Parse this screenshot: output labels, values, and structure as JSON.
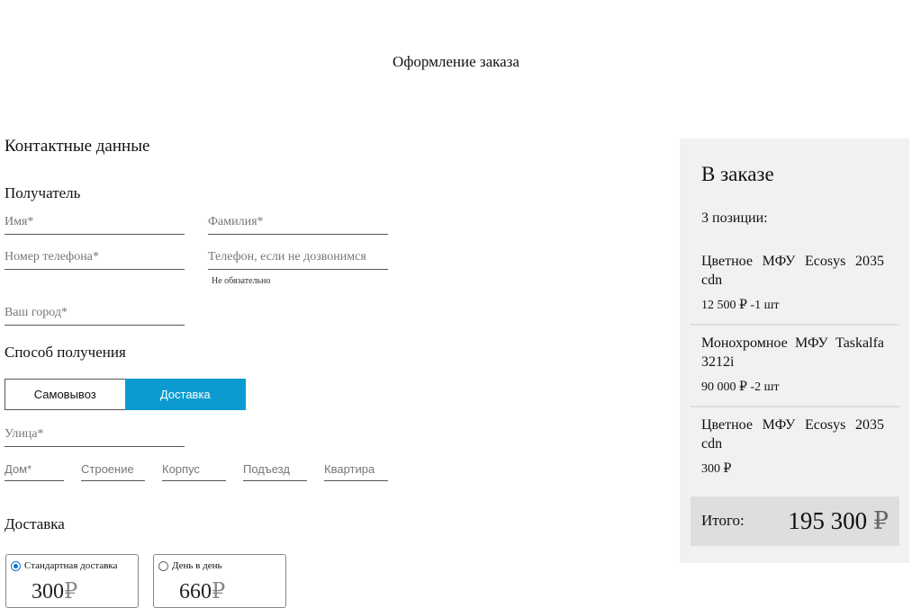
{
  "page_title": "Оформление заказа",
  "contact": {
    "title": "Контактные данные",
    "recipient_title": "Получатель",
    "first_name_placeholder": "Имя*",
    "last_name_placeholder": "Фамилия*",
    "phone_placeholder": "Номер телефона*",
    "alt_phone_placeholder": "Телефон, если не дозвонимся",
    "alt_phone_hint": "Не обязательно",
    "city_placeholder": "Ваш город*"
  },
  "method": {
    "title": "Способ получения",
    "pickup_label": "Самовывоз",
    "delivery_label": "Доставка",
    "selected": "Доставка"
  },
  "address": {
    "street_placeholder": "Улица*",
    "house_placeholder": "Дом*",
    "building_placeholder": "Строение",
    "block_placeholder": "Корпус",
    "entrance_placeholder": "Подъезд",
    "apartment_placeholder": "Квартира"
  },
  "delivery": {
    "title": "Доставка",
    "options": [
      {
        "label": "Стандартная доставка",
        "price": "300",
        "currency": "₽",
        "checked": true
      },
      {
        "label": "День в день",
        "price": "660",
        "currency": "₽",
        "checked": false
      }
    ]
  },
  "cart": {
    "title": "В заказе",
    "count": "3 позиции:",
    "items": [
      {
        "name": "Цветное МФУ Ecosys 2035 cdn",
        "price": "12 500 ₽ -1 шт"
      },
      {
        "name": "Монохромное МФУ Taskalfa 3212i",
        "price": "90 000 ₽ -2 шт"
      },
      {
        "name": "Цветное МФУ Ecosys 2035 cdn",
        "price": "300 ₽"
      }
    ],
    "total_label": "Итого:",
    "total_value": "195 300",
    "total_currency": "₽"
  },
  "colors": {
    "accent": "#0b9bd0",
    "cart_bg": "#f1f1f1",
    "total_bg": "#dedede"
  }
}
